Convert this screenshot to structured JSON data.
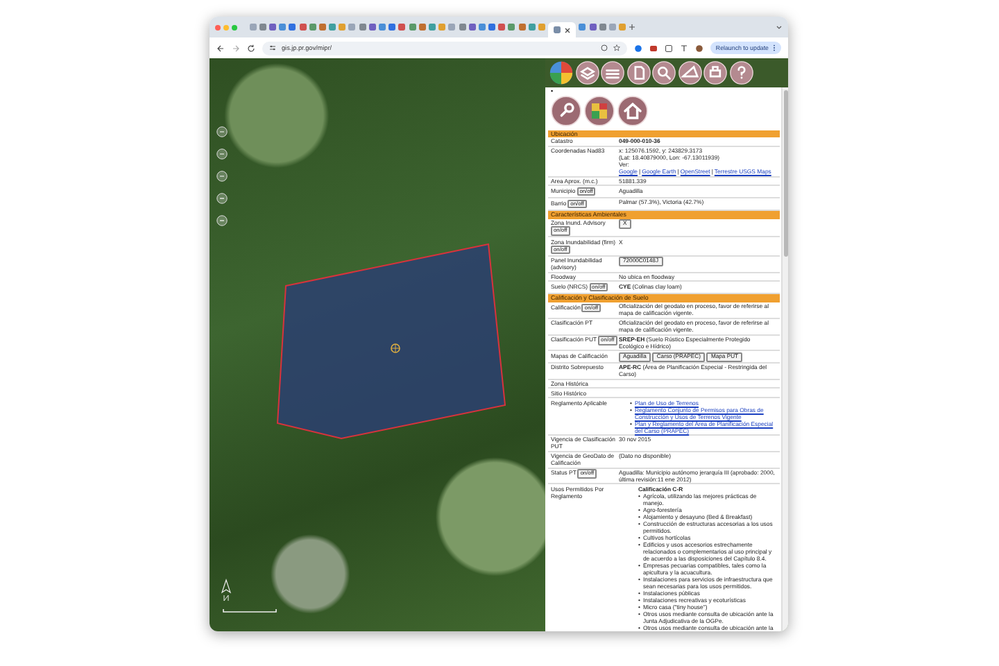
{
  "browser": {
    "url": "gis.jp.pr.gov/mipr/",
    "update_button": "Relaunch to update"
  },
  "panel": {
    "marker": "•",
    "sections": [
      {
        "title": "Ubicación",
        "rows": [
          {
            "label": "Catastro",
            "kind": "text",
            "value": "**049-000-010-36**"
          },
          {
            "label": "Coordenadas Nad83",
            "kind": "coords",
            "lines": [
              "x: 125076.1592, y: 243829.3173",
              "(Lat: 18.40879000, Lon: -67.13011939)"
            ],
            "links_prefix": "Ver:",
            "link_separator": "|",
            "links": [
              "Google",
              "Google Earth",
              "OpenStreet",
              "Terrestre USGS Maps"
            ]
          },
          {
            "label": "Area Aprox. (m.c.)",
            "kind": "text",
            "value": "51881.339"
          },
          {
            "label": "Municipio",
            "toggle": "on/off",
            "kind": "text",
            "value": "Aguadilla"
          },
          {
            "label": "Barrio",
            "toggle": "on/off",
            "kind": "text",
            "value": "Palmar (57.3%), Victoria (42.7%)"
          }
        ]
      },
      {
        "title": "Características Ambientales",
        "rows": [
          {
            "label": "Zona Inund. Advisory",
            "toggle": "on/off",
            "kind": "buttons",
            "buttons": [
              "X"
            ]
          },
          {
            "label": "Zona Inundabilidad (firm)",
            "toggle": "on/off",
            "kind": "text",
            "value": "X"
          },
          {
            "label": "Panel Inundabilidad (advisory)",
            "kind": "buttons",
            "buttons": [
              "72000C0148J"
            ]
          },
          {
            "label": "Floodway",
            "kind": "text",
            "value": "No ubica en floodway"
          },
          {
            "label": "Suelo (NRCS)",
            "toggle": "on/off",
            "kind": "text",
            "value": "**CYE** (Colinas clay loam)"
          }
        ]
      },
      {
        "title": "Calificación y Clasificación de Suelo",
        "rows": [
          {
            "label": "Calificación",
            "toggle": "on/off",
            "kind": "text",
            "value": "Oficialización del geodato en proceso, favor de referirse al mapa de calificación vigente."
          },
          {
            "label": "Clasificación PT",
            "kind": "text",
            "value": "Oficialización del geodato en proceso, favor de referirse al mapa de calificación vigente."
          },
          {
            "label": "Clasificación PUT",
            "toggle": "on/off",
            "kind": "text",
            "value": "**SREP-EH** (Suelo Rústico Especialmente Protegido Ecológico e Hídrico)"
          },
          {
            "label": "Mapas de Calificación",
            "kind": "buttons",
            "buttons": [
              "Aguadilla",
              "Carso (PRAPEC)",
              "Mapa PUT"
            ]
          },
          {
            "label": "Distrito Sobrepuesto",
            "kind": "text",
            "value": "**APE-RC** (Área de Planificación Especial - Restringida del Carso)"
          },
          {
            "label": "Zona Histórica",
            "kind": "empty"
          },
          {
            "label": "Sitio Histórico",
            "kind": "empty"
          },
          {
            "label": "Reglamento Aplicable",
            "kind": "links",
            "bullet": "•",
            "links": [
              "Plan de Uso de Terrenos",
              "Reglamento Conjunto de Permisos para Obras de Construcción y Usos de Terrenos Vigente",
              "Plan y Reglamento del Área de Planificación Especial del Carso (PRAPEC)"
            ]
          },
          {
            "label": "Vigencia de Clasificación PUT",
            "kind": "text",
            "value": "30 nov 2015"
          },
          {
            "label": "Vigencia de GeoDato de Calificación",
            "kind": "text",
            "value": "(Dato no disponible)"
          },
          {
            "label": "Status PT",
            "toggle": "on/off",
            "kind": "text",
            "value": "Aguadilla: Municipio autónomo jerarquía III (aprobado: 2000, última revisión:11 ene 2012)"
          },
          {
            "label": "Usos Permitidos Por Reglamento",
            "kind": "list",
            "heading": "Calificación C-R",
            "bullet": "•",
            "items": [
              "Agrícola, utilizando las mejores prácticas de manejo.",
              "Agro-forestería",
              "Alojamiento y desayuno (Bed & Breakfast)",
              "Construcción de estructuras accesorias a los usos permitidos.",
              "Cultivos hortícolas",
              "Edificios y usos accesorios estrechamente relacionados o complementarios al uso principal y de acuerdo a las disposiciones del Capítulo 8.4.",
              "Empresas pecuarias compatibles, tales como la apicultura y la acuacultura.",
              "Instalaciones para servicios de infraestructura que sean necesarias para los usos permitidos.",
              "Instalaciones públicas",
              "Instalaciones recreativas y ecoturísticas",
              "Micro casa (\"tiny house\")",
              "Otros usos mediante consulta de ubicación ante la Junta Adjudicativa de la OGPe.",
              "Otros usos mediante consulta de ubicación ante la"
            ]
          }
        ]
      }
    ]
  }
}
